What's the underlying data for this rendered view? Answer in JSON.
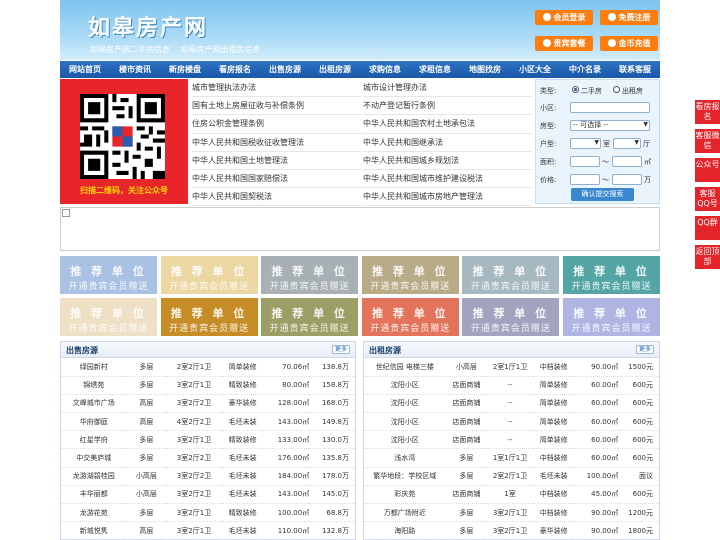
{
  "header": {
    "logo": "如皋房产网",
    "sublinks": [
      "如皋房产网二手房信息",
      "如皋房产网出租房信息"
    ],
    "buttons": [
      {
        "label": "会员登录",
        "color": "#ff7d0e"
      },
      {
        "label": "免费注册",
        "color": "#ff7d0e"
      },
      {
        "label": "贵宾套餐",
        "color": "#ff7d0e"
      },
      {
        "label": "金币充值",
        "color": "#ff7d0e"
      }
    ]
  },
  "nav": [
    "网站首页",
    "楼市资讯",
    "新房楼盘",
    "看房报名",
    "出售房源",
    "出租房源",
    "求购信息",
    "求租信息",
    "地图找房",
    "小区大全",
    "中介名录",
    "联系客服"
  ],
  "qr": {
    "caption": "扫描二维码，关注公众号"
  },
  "laws_left": [
    "城市管理执法办法",
    "国有土地上房屋征收与补偿条例",
    "住房公积金管理条例",
    "中华人民共和国税收征收管理法",
    "中华人民共和国土地管理法",
    "中华人民共和国国家赔偿法",
    "中华人民共和国契税法"
  ],
  "laws_right": [
    "城市设计管理办法",
    "不动产登记暂行条例",
    "中华人民共和国农村土地承包法",
    "中华人民共和国继承法",
    "中华人民共和国城乡规划法",
    "中华人民共和国城市维护建设税法",
    "中华人民共和国城市房地产管理法"
  ],
  "search": {
    "type_label": "类型:",
    "radio1": "二手房",
    "radio2": "出租房",
    "xiaoqu_label": "小区:",
    "fangxing_label": "房型:",
    "fangxing_value": "-- 可选择 --",
    "huxing_label": "户型:",
    "shi": "室",
    "ting": "厅",
    "area_label": "面积:",
    "price_label": "价格:",
    "tilde": "～",
    "sqm": "㎡",
    "wan": "万",
    "submit": "确认提交搜索"
  },
  "ads": {
    "line1": "推 荐 单 位",
    "line2": "开通贵宾会员赠送",
    "colors_row1": [
      "#a9c1e2",
      "#ecd7a2",
      "#a7b1b5",
      "#b8ac88",
      "#a6b8c0",
      "#54a6a4"
    ],
    "colors_row2": [
      "#eee0c4",
      "#c68d27",
      "#9d9d66",
      "#e3735a",
      "#a3a3bf",
      "#afb4e2"
    ]
  },
  "sale": {
    "title": "出售房源",
    "more": "更多",
    "rows": [
      [
        "绿园新村",
        "多层",
        "2室2厅1卫",
        "简单装修",
        "70.06㎡",
        "138.8万"
      ],
      [
        "锦绣苑",
        "多层",
        "3室2厅1卫",
        "精致装修",
        "80.00㎡",
        "158.8万"
      ],
      [
        "文峰城市广场",
        "高层",
        "3室2厅2卫",
        "豪华装修",
        "128.00㎡",
        "168.0万"
      ],
      [
        "华府御庭",
        "高层",
        "4室2厅2卫",
        "毛坯未装",
        "143.00㎡",
        "149.8万"
      ],
      [
        "红星学府",
        "多层",
        "3室2厅1卫",
        "精致装修",
        "133.00㎡",
        "130.0万"
      ],
      [
        "中交美庐城",
        "多层",
        "3室2厅2卫",
        "毛坯未装",
        "176.00㎡",
        "135.8万"
      ],
      [
        "龙游湖碧桂园",
        "小高层",
        "3室2厅2卫",
        "毛坯未装",
        "184.00㎡",
        "178.0万"
      ],
      [
        "丰华丽都",
        "小高层",
        "3室2厅2卫",
        "毛坯未装",
        "143.00㎡",
        "145.0万"
      ],
      [
        "龙游花苑",
        "多层",
        "3室2厅1卫",
        "精致装修",
        "100.00㎡",
        "68.8万"
      ],
      [
        "新城悦隽",
        "高层",
        "3室2厅1卫",
        "毛坯未装",
        "110.00㎡",
        "132.8万"
      ]
    ]
  },
  "rent": {
    "title": "出租房源",
    "more": "更多",
    "rows": [
      [
        "世纪信园 电梯三楼",
        "小高层",
        "2室1厅1卫",
        "中档装修",
        "90.00㎡",
        "1500元"
      ],
      [
        "沈阳小区",
        "店面商铺",
        "--",
        "简单装修",
        "60.00㎡",
        "600元"
      ],
      [
        "沈阳小区",
        "店面商铺",
        "--",
        "简单装修",
        "60.00㎡",
        "600元"
      ],
      [
        "沈阳小区",
        "店面商铺",
        "--",
        "简单装修",
        "60.00㎡",
        "600元"
      ],
      [
        "沈阳小区",
        "店面商铺",
        "--",
        "简单装修",
        "60.00㎡",
        "600元"
      ],
      [
        "浅水湾",
        "多层",
        "1室1厅1卫",
        "中档装修",
        "60.00㎡",
        "600元"
      ],
      [
        "繁华地段：学校区域",
        "多层",
        "2室2厅1卫",
        "毛坯未装",
        "100.00㎡",
        "面议"
      ],
      [
        "彩庆苑",
        "店面商铺",
        "1室",
        "中档装修",
        "45.00㎡",
        "600元"
      ],
      [
        "万都广场附近",
        "多层",
        "3室2厅1卫",
        "中档装修",
        "90.00㎡",
        "1200元"
      ],
      [
        "海阳路",
        "多层",
        "3室2厅1卫",
        "豪华装修",
        "90.00㎡",
        "1800元"
      ]
    ]
  },
  "side": [
    "看房报名",
    "客服微信",
    "公众号",
    "客服QQ号",
    "QQ群",
    "返回顶部"
  ]
}
